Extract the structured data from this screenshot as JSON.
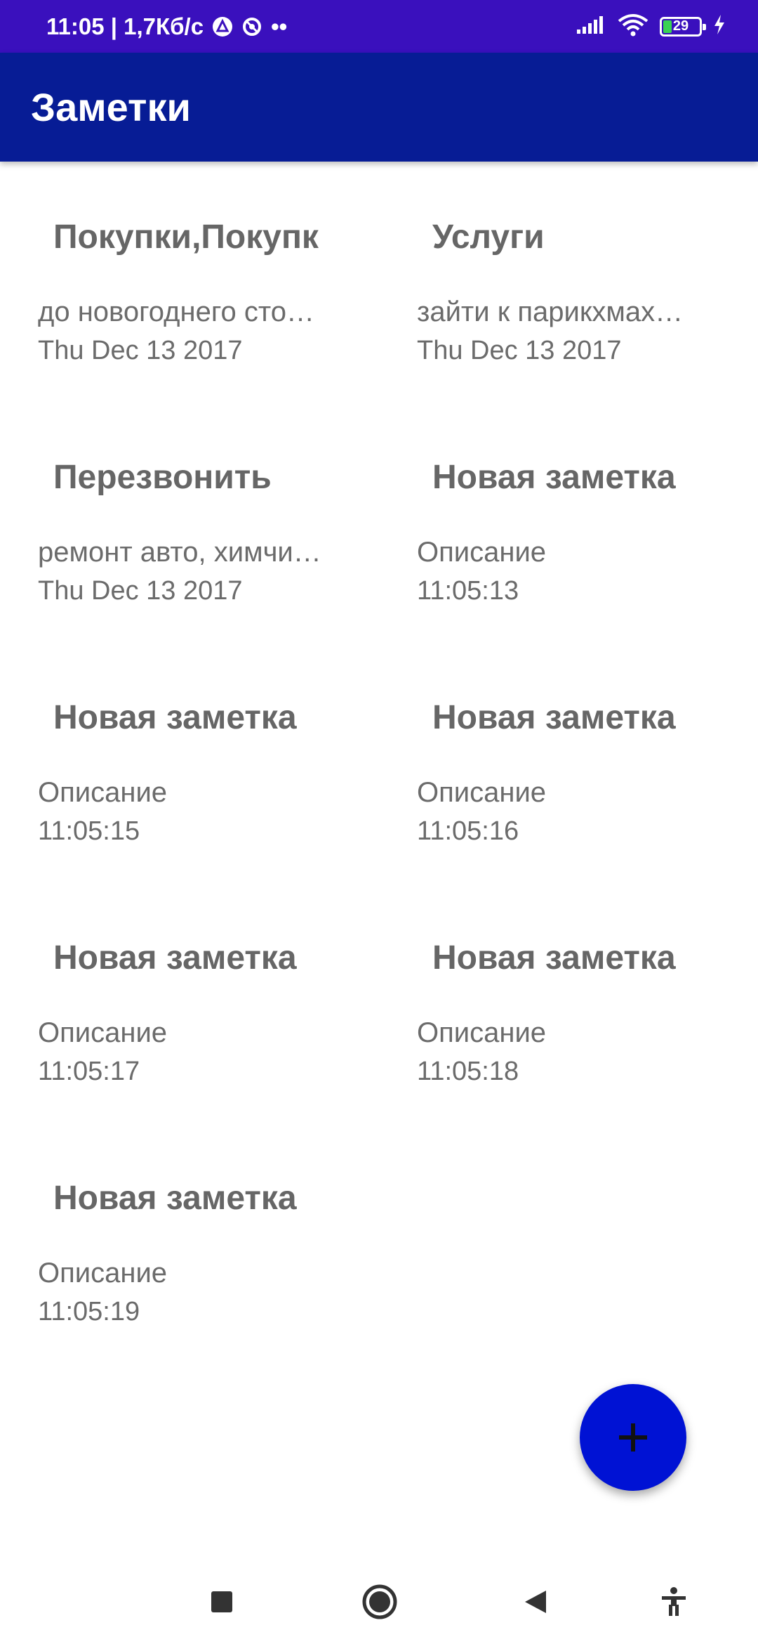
{
  "status_bar": {
    "time_speed": "11:05 | 1,7Кб/с",
    "dots": "••",
    "battery": "29"
  },
  "app_bar": {
    "title": "Заметки"
  },
  "notes": [
    {
      "title": "Покупки,Покупк",
      "description": "до новогоднего сто…",
      "date": "Thu Dec 13 2017"
    },
    {
      "title": "Услуги",
      "description": "зайти к парикхмах…",
      "date": "Thu Dec 13 2017"
    },
    {
      "title": "Перезвонить",
      "description": "ремонт авто, химчи…",
      "date": "Thu Dec 13 2017"
    },
    {
      "title": "Новая заметка",
      "description": "Описание",
      "date": "11:05:13"
    },
    {
      "title": "Новая заметка",
      "description": "Описание",
      "date": "11:05:15"
    },
    {
      "title": "Новая заметка",
      "description": "Описание",
      "date": "11:05:16"
    },
    {
      "title": "Новая заметка",
      "description": "Описание",
      "date": "11:05:17"
    },
    {
      "title": "Новая заметка",
      "description": "Описание",
      "date": "11:05:18"
    },
    {
      "title": "Новая заметка",
      "description": "Описание",
      "date": "11:05:19"
    }
  ],
  "fab": {
    "icon": "plus-icon"
  },
  "nav": {
    "icons": [
      "recents-square-icon",
      "home-circle-icon",
      "back-triangle-icon",
      "accessibility-icon"
    ]
  },
  "colors": {
    "status_bar": "#3a10bd",
    "app_bar": "#071c95",
    "fab": "#0012d4",
    "note_text": "#6b6b6b"
  }
}
